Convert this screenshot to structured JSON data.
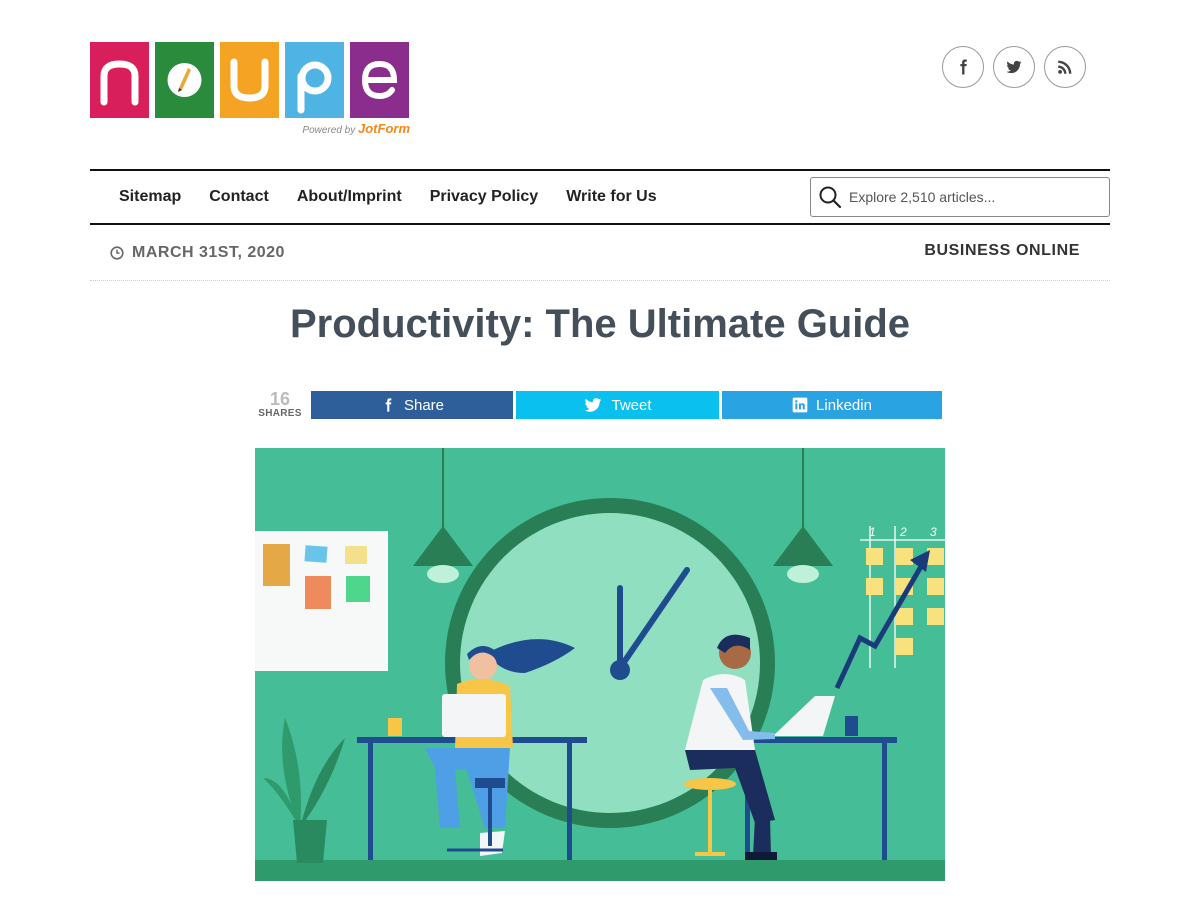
{
  "logo": {
    "letters": [
      "n",
      "o",
      "u",
      "p",
      "e"
    ],
    "tile_colors": [
      "#d81e5b",
      "#2a8b3d",
      "#f5a323",
      "#4fb3e3",
      "#8a2d8c"
    ],
    "powered_by": "Powered by",
    "powered_brand": "JotForm"
  },
  "social": {
    "icons": [
      "facebook-icon",
      "twitter-icon",
      "rss-icon"
    ]
  },
  "nav": {
    "links": [
      "Sitemap",
      "Contact",
      "About/Imprint",
      "Privacy Policy",
      "Write for Us"
    ]
  },
  "search": {
    "placeholder": "Explore 2,510 articles..."
  },
  "meta": {
    "date": "MARCH 31ST, 2020",
    "category": "BUSINESS ONLINE"
  },
  "article": {
    "title": "Productivity: The Ultimate Guide"
  },
  "share": {
    "count": "16",
    "count_label": "SHARES",
    "facebook_label": "Share",
    "twitter_label": "Tweet",
    "linkedin_label": "Linkedin",
    "colors": {
      "facebook": "#2f5f9a",
      "twitter": "#09c0ef",
      "linkedin": "#2aa3e2"
    }
  },
  "hero": {
    "chart_columns": [
      "1",
      "2",
      "3"
    ]
  }
}
